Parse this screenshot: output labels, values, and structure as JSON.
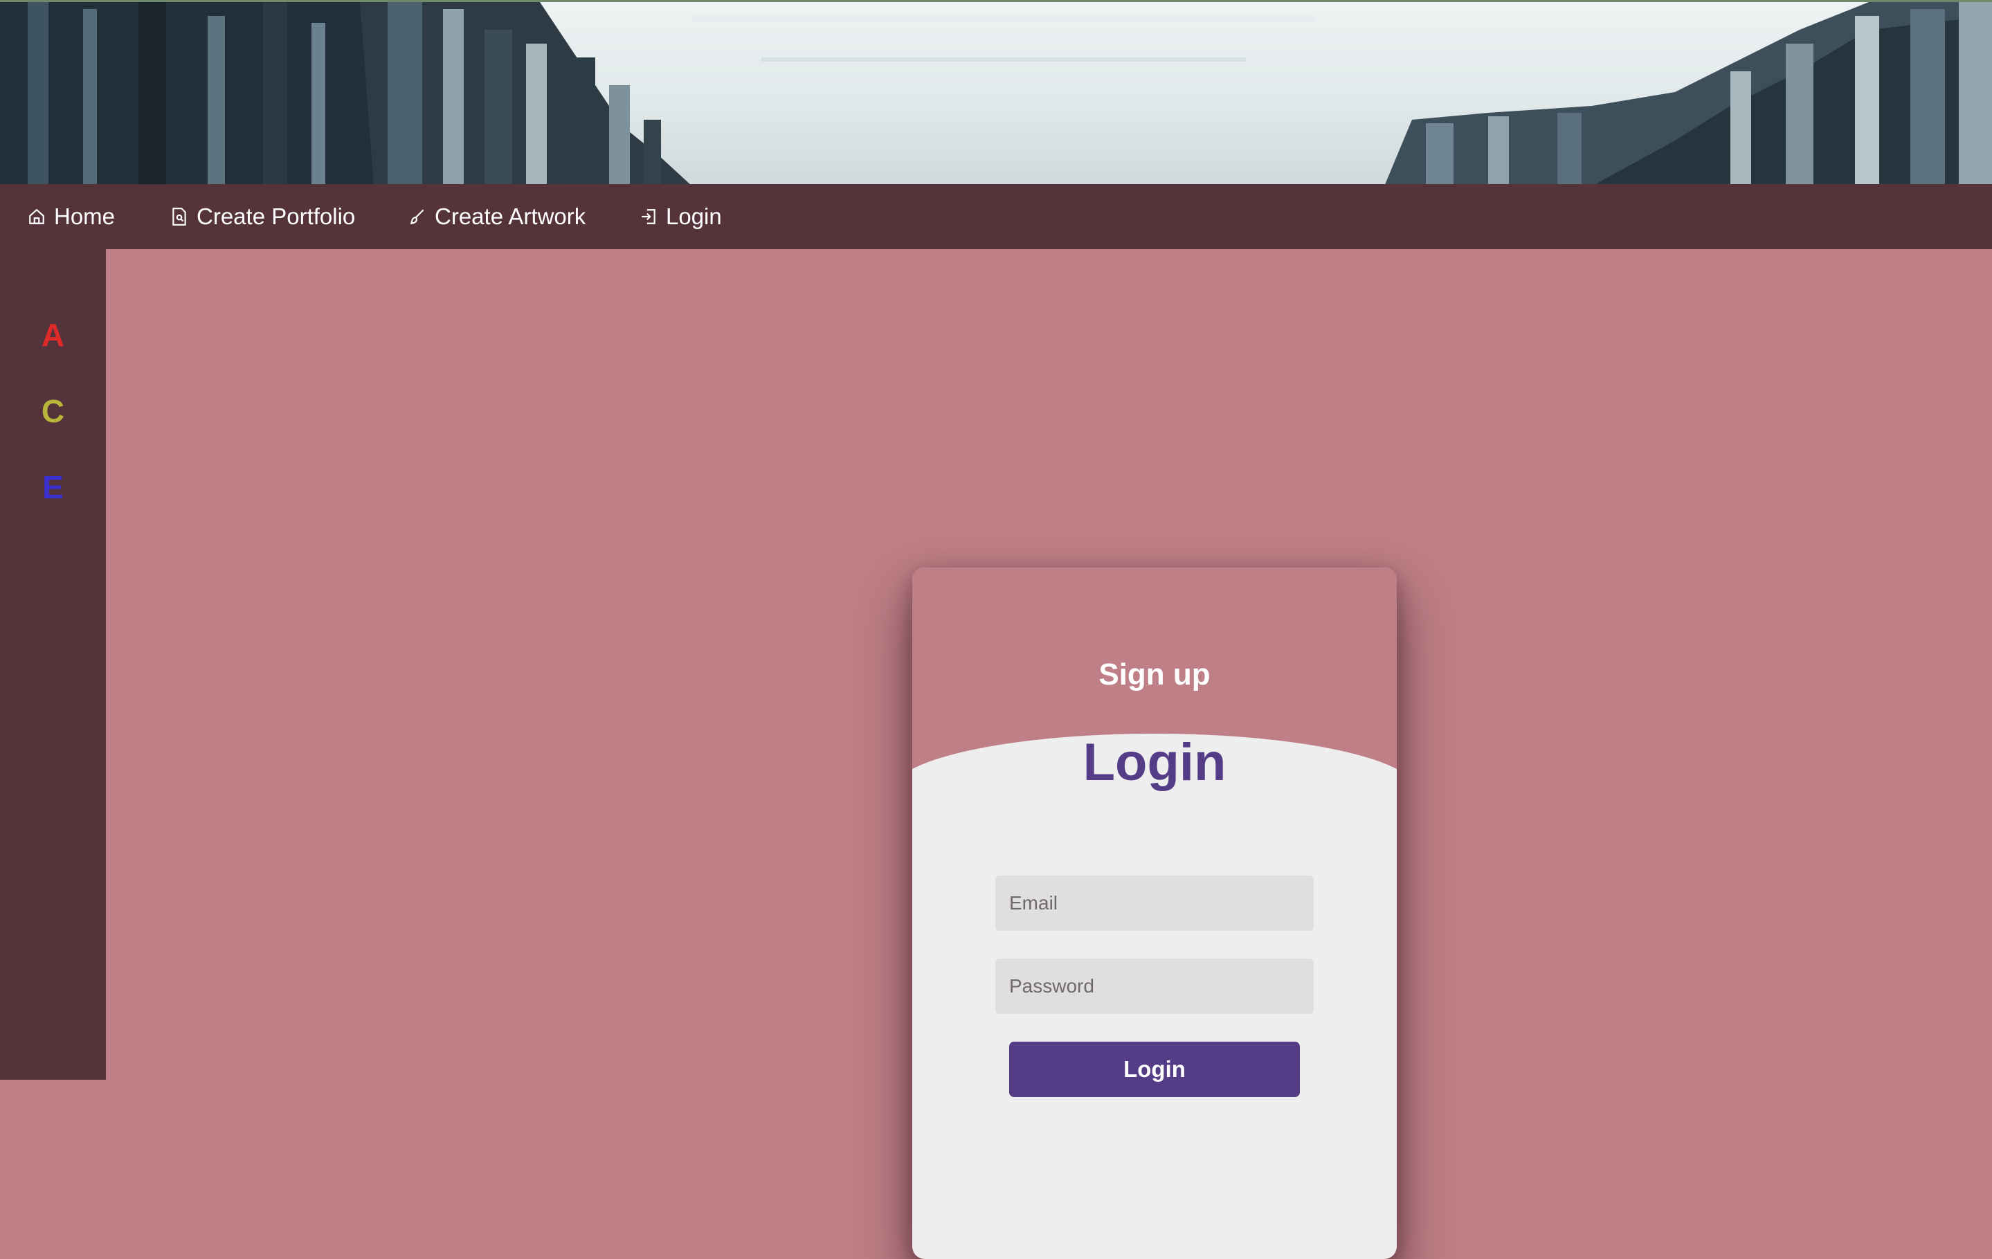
{
  "nav": {
    "items": [
      {
        "label": "Home",
        "icon": "home-icon"
      },
      {
        "label": "Create Portfolio",
        "icon": "document-icon"
      },
      {
        "label": "Create Artwork",
        "icon": "brush-icon"
      },
      {
        "label": "Login",
        "icon": "login-icon"
      }
    ]
  },
  "sidebar": {
    "letters": [
      {
        "label": "A",
        "color": "#e02a2a"
      },
      {
        "label": "C",
        "color": "#b8b63a"
      },
      {
        "label": "E",
        "color": "#3a2fd0"
      }
    ]
  },
  "card": {
    "signup_label": "Sign up",
    "title": "Login",
    "email_placeholder": "Email",
    "password_placeholder": "Password",
    "submit_label": "Login"
  },
  "colors": {
    "nav_bg": "#54333a",
    "page_bg": "#be7f86",
    "accent": "#553c86"
  }
}
